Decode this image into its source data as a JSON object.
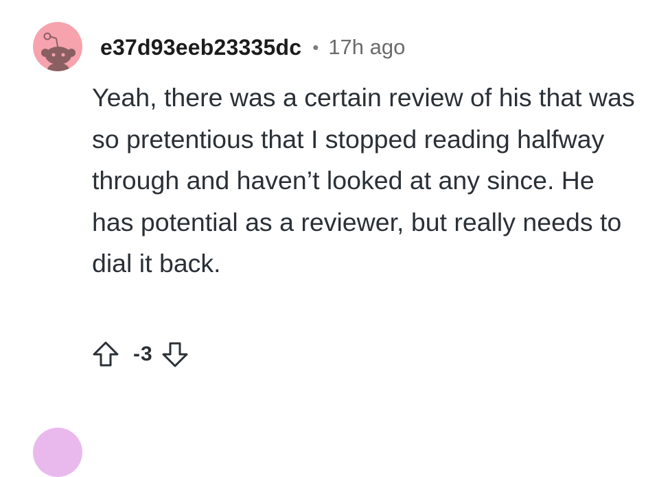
{
  "comment": {
    "username": "e37d93eeb23335dc",
    "separator": "•",
    "timestamp": "17h ago",
    "body": "Yeah, there was a certain review of his that was so pretentious that I stopped reading halfway through and haven’t looked at any since. He has potential as a reviewer, but really needs to dial it back.",
    "score": "-3",
    "avatar_color": "#f6a3ae",
    "avatar_icon": "snoo-avatar-icon",
    "upvote_icon": "upvote-arrow-icon",
    "downvote_icon": "downvote-arrow-icon"
  },
  "next_comment": {
    "avatar_color": "#e9b9ee"
  }
}
